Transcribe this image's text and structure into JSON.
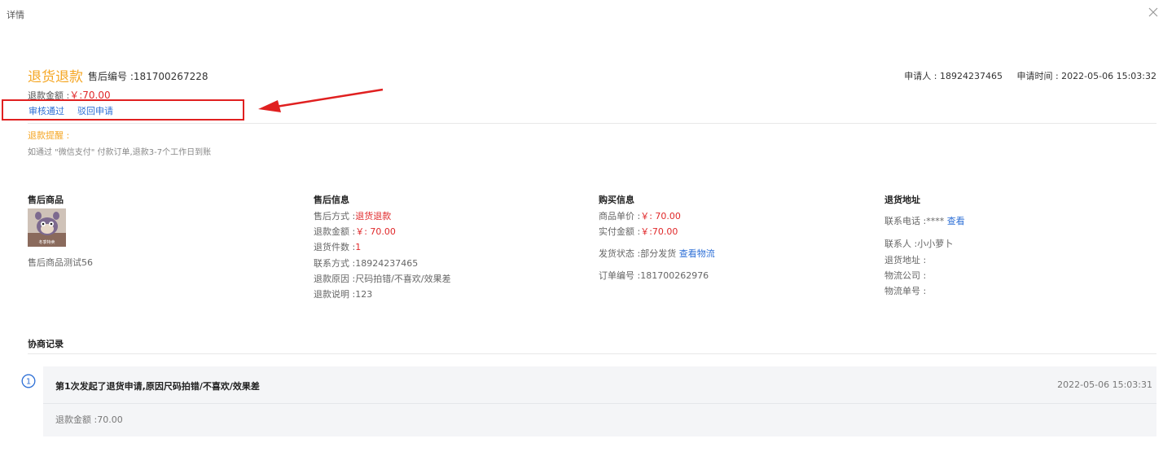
{
  "dialog": {
    "title": "详情"
  },
  "header": {
    "type": "退货退款",
    "sn_label": "售后编号 :",
    "sn_value": "181700267228",
    "applicant_label": "申请人 :",
    "applicant_value": "18924237465",
    "apply_time_label": "申请时间 :",
    "apply_time_value": "2022-05-06 15:03:32",
    "refund_label": "退款金额 :",
    "refund_value": "￥:70.00"
  },
  "actions": {
    "approve": "审核通过",
    "reject": "驳回申请"
  },
  "reminder": {
    "title": "退款提醒 :",
    "text": "如通过 \"微信支付\" 付款订单,退款3-7个工作日到账"
  },
  "product": {
    "heading": "售后商品",
    "name": "售后商品测试56",
    "image_caption": "冬季特卖"
  },
  "after_sale": {
    "heading": "售后信息",
    "method_label": "售后方式 :",
    "method_value": "退货退款",
    "amount_label": "退款金额 :",
    "amount_value": "￥: 70.00",
    "count_label": "退货件数 :",
    "count_value": "1",
    "contact_label": "联系方式 :",
    "contact_value": "18924237465",
    "reason_label": "退款原因 :",
    "reason_value": "尺码拍错/不喜欢/效果差",
    "note_label": "退款说明 :",
    "note_value": "123"
  },
  "purchase": {
    "heading": "购买信息",
    "unit_price_label": "商品单价 :",
    "unit_price_value": "￥: 70.00",
    "paid_label": "实付金额 :",
    "paid_value": "￥:70.00",
    "ship_status_label": "发货状态 :",
    "ship_status_value": "部分发货",
    "logistics_link": "查看物流",
    "order_no_label": "订单编号 :",
    "order_no_value": "181700262976"
  },
  "return_address": {
    "heading": "退货地址",
    "phone_label": "联系电话 :",
    "phone_value": "****",
    "phone_link": "查看",
    "contact_label": "联系人 :",
    "contact_value": "小小萝卜",
    "address_label": "退货地址 :",
    "company_label": "物流公司 :",
    "tracking_label": "物流单号 :"
  },
  "negotiation": {
    "heading": "协商记录",
    "records": [
      {
        "index": "1",
        "title": "第1次发起了退货申请,原因尺码拍错/不喜欢/效果差",
        "time": "2022-05-06 15:03:31",
        "detail": "退款金额 :70.00"
      }
    ]
  },
  "colors": {
    "accent_orange": "#f5a623",
    "money_red": "#e0282a",
    "link_blue": "#2d6fd6",
    "annotation_red": "#e02020"
  }
}
